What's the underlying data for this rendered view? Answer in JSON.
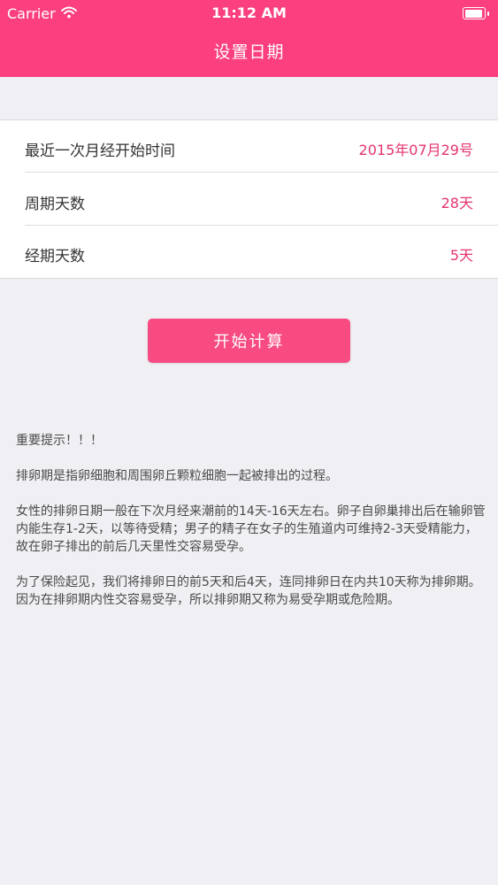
{
  "status_bar": {
    "carrier": "Carrier",
    "time": "11:12 AM"
  },
  "nav": {
    "title": "设置日期"
  },
  "form": {
    "rows": [
      {
        "label": "最近一次月经开始时间",
        "value": "2015年07月29号"
      },
      {
        "label": "周期天数",
        "value": "28天"
      },
      {
        "label": "经期天数",
        "value": "5天"
      }
    ]
  },
  "actions": {
    "start_label": "开始计算"
  },
  "tips": {
    "heading": "重要提示！！！",
    "p1": "排卵期是指卵细胞和周围卵丘颗粒细胞一起被排出的过程。",
    "p2": "女性的排卵日期一般在下次月经来潮前的14天-16天左右。卵子自卵巢排出后在输卵管内能生存1-2天，以等待受精；男子的精子在女子的生殖道内可维持2-3天受精能力，故在卵子排出的前后几天里性交容易受孕。",
    "p3": "为了保险起见，我们将排卵日的前5天和后4天，连同排卵日在内共10天称为排卵期。因为在排卵期内性交容易受孕，所以排卵期又称为易受孕期或危险期。"
  },
  "colors": {
    "nav_background": "#fb3f7f",
    "accent_value": "#e4336f",
    "button_background": "#f74b81",
    "page_background": "#efeff4"
  },
  "icons": {
    "signal": "wifi-icon",
    "battery": "battery-icon"
  }
}
